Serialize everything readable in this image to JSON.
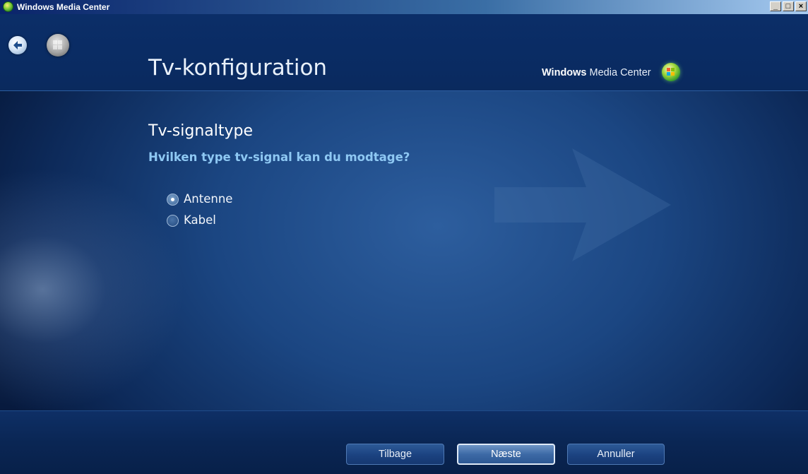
{
  "window": {
    "title": "Windows Media Center",
    "controls": {
      "minimize": "_",
      "maximize": "□",
      "close": "×"
    }
  },
  "header": {
    "page_title": "Tv-konfiguration",
    "brand_bold": "Windows",
    "brand_rest": " Media Center"
  },
  "icons": {
    "back": "back-arrow-icon",
    "start": "windows-start-orb-icon",
    "brand_logo": "media-center-logo-icon",
    "background": "large-arrow-decoration"
  },
  "main": {
    "section_title": "Tv-signaltype",
    "question": "Hvilken type tv-signal kan du modtage?",
    "options": [
      {
        "label": "Antenne",
        "selected": true
      },
      {
        "label": "Kabel",
        "selected": false
      }
    ]
  },
  "footer": {
    "back_label": "Tilbage",
    "next_label": "Næste",
    "cancel_label": "Annuller",
    "focused": "next"
  },
  "colors": {
    "background": "#1b4682",
    "question_text": "#8ec8f3",
    "title_bar": "#0a246a"
  }
}
